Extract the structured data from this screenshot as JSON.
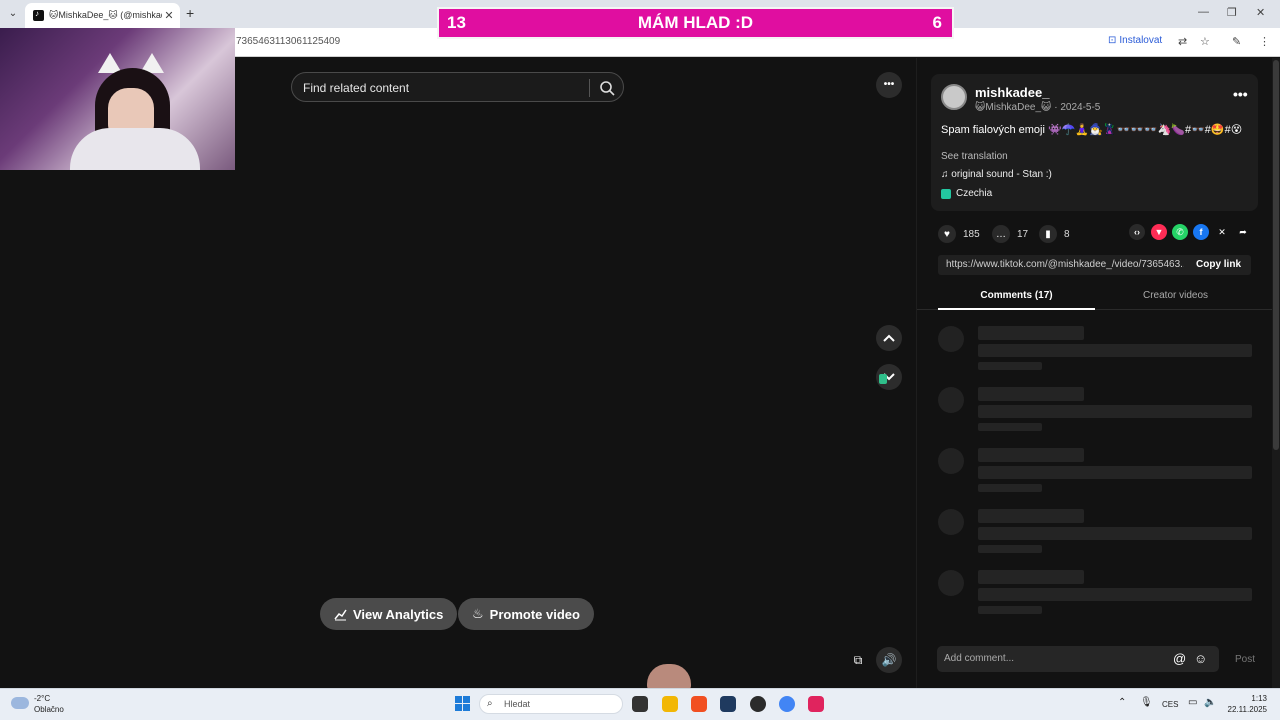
{
  "browser": {
    "tab_title": "🐱MishkaDee_🐱 (@mishkade",
    "tab_close": "✕",
    "new_tab": "+",
    "url": "7365463113061125409",
    "install_label": "Instalovat"
  },
  "overlay": {
    "left_number": "13",
    "title": "MÁM HLAD :D",
    "right_number": "6"
  },
  "video": {
    "search_placeholder": "Find related content",
    "more": "•••",
    "view_analytics": "View Analytics",
    "promote_video": "Promote video"
  },
  "post": {
    "username": "mishkadee_",
    "meta": "😺MishkaDee_😺 · 2024-5-5",
    "description": "Spam fialových emoji 👾☂️🧘‍♀️🧙‍♂️🦹👓👓👓🦄🍆#👓#🤩#😵",
    "see_translation": "See translation",
    "sound": "♫  original sound - Stan :)",
    "location": "Czechia",
    "more": "•••"
  },
  "stats": {
    "likes": "185",
    "comments": "17",
    "saves": "8"
  },
  "share": {
    "link": "https://www.tiktok.com/@mishkadee_/video/7365463...",
    "copy_link": "Copy link"
  },
  "panel_tabs": {
    "comments": "Comments (17)",
    "creator_videos": "Creator videos"
  },
  "comment_input": {
    "placeholder": "Add comment...",
    "post": "Post"
  },
  "taskbar": {
    "temperature": "-2°C",
    "weather": "Oblačno",
    "search_label": "Hledat",
    "language": "CES",
    "time": "1:13",
    "date": "22.11.2025"
  },
  "colors": {
    "banner": "#e00ea0",
    "background": "#121212",
    "accent_link": "#2a5bd7"
  }
}
